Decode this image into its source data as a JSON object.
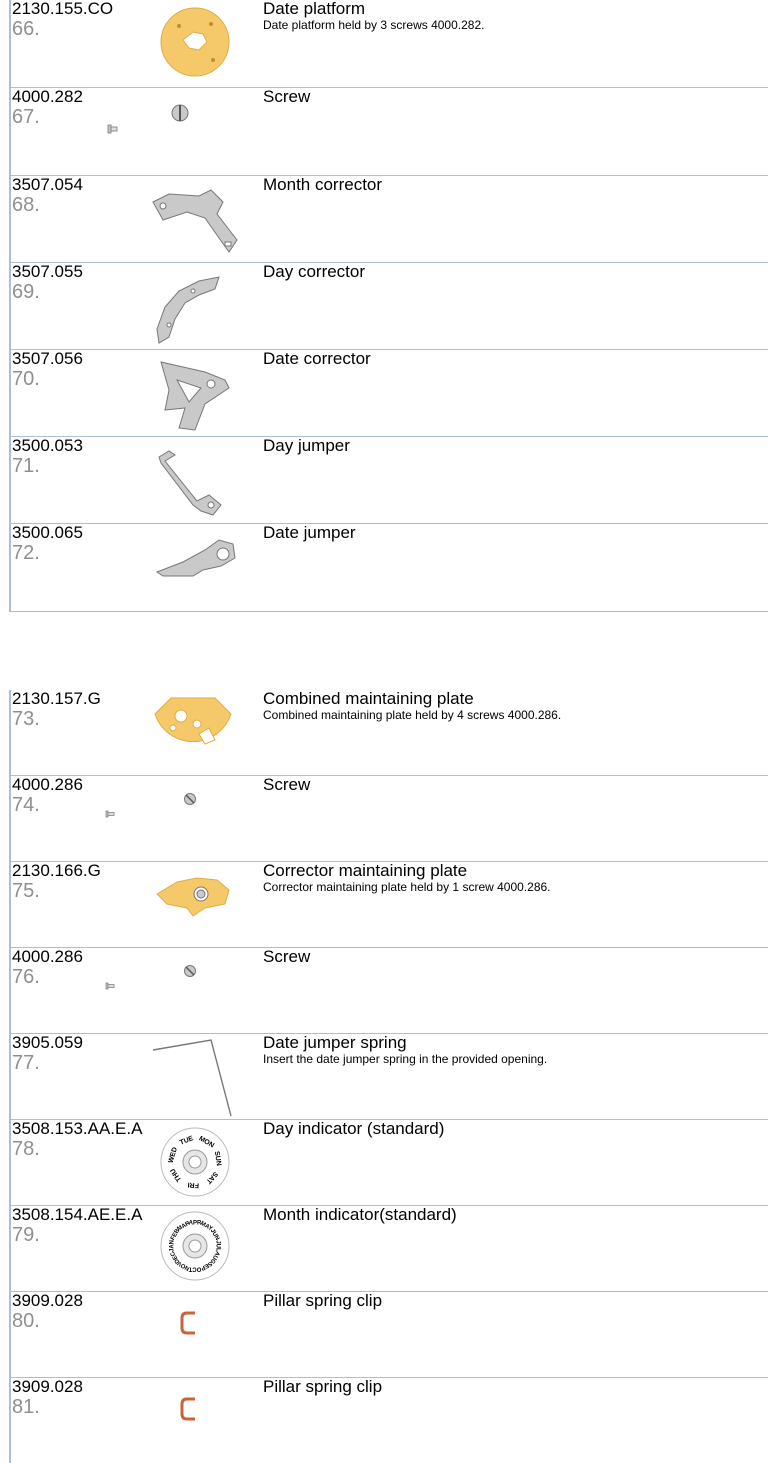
{
  "groups": [
    {
      "parts": [
        {
          "ref": "2130.155.CO",
          "num": "66.",
          "title": "Date platform",
          "desc": "Date platform held by 3 screws 4000.282.",
          "icon": "date-platform-icon"
        },
        {
          "ref": "4000.282",
          "num": "67.",
          "title": "Screw",
          "desc": "",
          "icon": "screw-icon"
        },
        {
          "ref": "3507.054",
          "num": "68.",
          "title": "Month corrector",
          "desc": "",
          "icon": "month-corrector-icon"
        },
        {
          "ref": "3507.055",
          "num": "69.",
          "title": "Day corrector",
          "desc": "",
          "icon": "day-corrector-icon"
        },
        {
          "ref": "3507.056",
          "num": "70.",
          "title": "Date corrector",
          "desc": "",
          "icon": "date-corrector-icon"
        },
        {
          "ref": "3500.053",
          "num": "71.",
          "title": "Day jumper",
          "desc": "",
          "icon": "day-jumper-icon"
        },
        {
          "ref": "3500.065",
          "num": "72.",
          "title": "Date jumper",
          "desc": "",
          "icon": "date-jumper-icon"
        }
      ]
    },
    {
      "parts": [
        {
          "ref": "2130.157.G",
          "num": "73.",
          "title": "Combined maintaining plate",
          "desc": "Combined maintaining plate held by 4 screws 4000.286.",
          "icon": "maintaining-plate-icon"
        },
        {
          "ref": "4000.286",
          "num": "74.",
          "title": "Screw",
          "desc": "",
          "icon": "screw-icon"
        },
        {
          "ref": "2130.166.G",
          "num": "75.",
          "title": "Corrector maintaining plate",
          "desc": "Corrector maintaining plate held by 1 screw 4000.286.",
          "icon": "corrector-plate-icon"
        },
        {
          "ref": "4000.286",
          "num": "76.",
          "title": "Screw",
          "desc": "",
          "icon": "screw-icon"
        },
        {
          "ref": "3905.059",
          "num": "77.",
          "title": "Date jumper spring",
          "desc": "Insert the date jumper spring in the provided opening.",
          "icon": "spring-icon"
        },
        {
          "ref": "3508.153.AA.E.A",
          "num": "78.",
          "title": "Day indicator (standard)",
          "desc": "",
          "icon": "day-disc-icon",
          "disc_labels": [
            "MON",
            "SUN",
            "SAT",
            "FRI",
            "THU",
            "WED",
            "TUE"
          ]
        },
        {
          "ref": "3508.154.AE.E.A",
          "num": "79.",
          "title": "Month indicator(standard)",
          "desc": "",
          "icon": "month-disc-icon",
          "disc_labels": [
            "JAN",
            "FEB",
            "MAR",
            "APR",
            "MAY",
            "JUN",
            "JUL",
            "AUG",
            "SEP",
            "OCT",
            "NOV",
            "DEC"
          ]
        },
        {
          "ref": "3909.028",
          "num": "80.",
          "title": "Pillar spring clip",
          "desc": "",
          "icon": "spring-clip-icon"
        },
        {
          "ref": "3909.028",
          "num": "81.",
          "title": "Pillar spring clip",
          "desc": "",
          "icon": "spring-clip-icon"
        }
      ]
    }
  ],
  "colors": {
    "rule": "#aebfd3",
    "number": "#8f8f8f",
    "gold": "#f5c96a",
    "steel": "#c9c9c9",
    "copper": "#c8633c"
  }
}
